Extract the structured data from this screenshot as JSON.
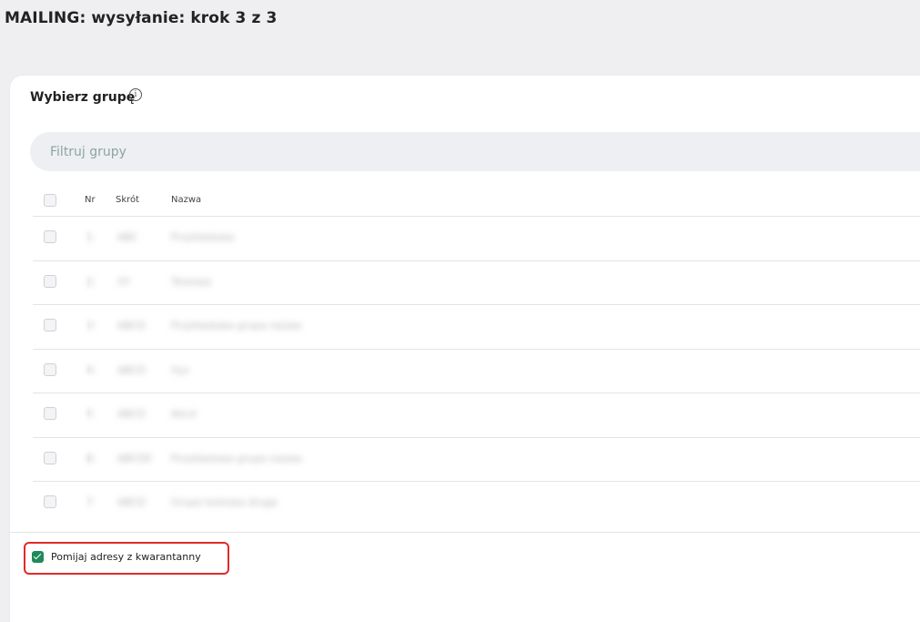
{
  "page": {
    "title": "MAILING: wysyłanie: krok 3 z 3"
  },
  "group_section": {
    "title": "Wybierz grupę",
    "info_icon": "info-icon",
    "filter_placeholder": "Filtruj grupy"
  },
  "table": {
    "columns": [
      "Nr",
      "Skrót",
      "Nazwa"
    ],
    "rows": [
      {
        "nr": "1",
        "skrot": "ABC",
        "nazwa": "Przykładowa"
      },
      {
        "nr": "2",
        "skrot": "XY",
        "nazwa": "Testowa"
      },
      {
        "nr": "3",
        "skrot": "ABCD",
        "nazwa": "Przykładowa grupa nazwa"
      },
      {
        "nr": "4",
        "skrot": "ABCD",
        "nazwa": "Xyz"
      },
      {
        "nr": "5",
        "skrot": "ABCD",
        "nazwa": "Abcd"
      },
      {
        "nr": "6",
        "skrot": "ABCDE",
        "nazwa": "Przykładowa grupa nazwa"
      },
      {
        "nr": "7",
        "skrot": "ABCD",
        "nazwa": "Grupa testowa druga"
      }
    ]
  },
  "options": {
    "skip_quarantine_label": "Pomijaj adresy z kwarantanny",
    "skip_quarantine_checked": true,
    "accent_color": "#1f8a5b",
    "highlight_color": "#e12a2a"
  }
}
